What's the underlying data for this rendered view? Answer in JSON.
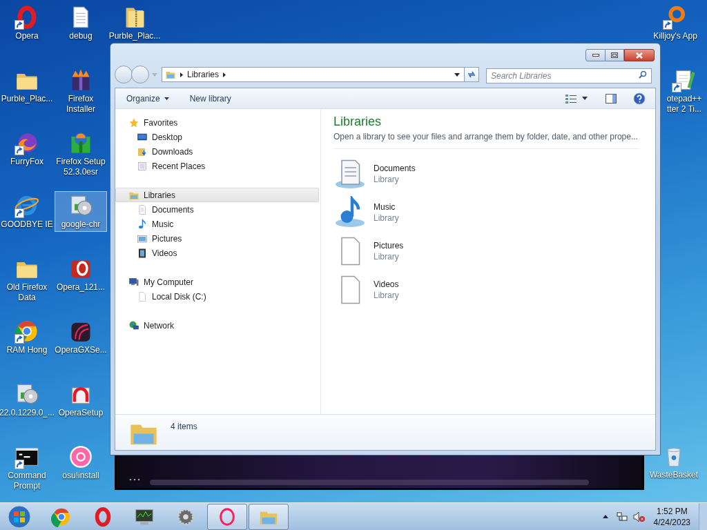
{
  "desktop_icons": [
    {
      "lines": [
        "Opera"
      ],
      "kind": "opera",
      "shortcut": true,
      "selected": false
    },
    {
      "lines": [
        "Purble_Plac..."
      ],
      "kind": "folder",
      "shortcut": false,
      "selected": false
    },
    {
      "lines": [
        "FurryFox"
      ],
      "kind": "firefox",
      "shortcut": true,
      "selected": false
    },
    {
      "lines": [
        "GOODBYE IE"
      ],
      "kind": "ie",
      "shortcut": true,
      "selected": false
    },
    {
      "lines": [
        "Old Firefox",
        "Data"
      ],
      "kind": "folder",
      "shortcut": false,
      "selected": false
    },
    {
      "lines": [
        "RAM Hong"
      ],
      "kind": "chrome",
      "shortcut": true,
      "selected": false
    },
    {
      "lines": [
        "22.0.1229.0_..."
      ],
      "kind": "disc",
      "shortcut": false,
      "selected": false
    },
    {
      "lines": [
        "Command",
        "Prompt"
      ],
      "kind": "cmd",
      "shortcut": true,
      "selected": false
    },
    {
      "lines": [
        "debug"
      ],
      "kind": "text",
      "shortcut": false,
      "selected": false
    },
    {
      "lines": [
        "Firefox",
        "Installer"
      ],
      "kind": "firefox-box",
      "shortcut": false,
      "selected": false
    },
    {
      "lines": [
        "Firefox Setup",
        "52.3.0esr"
      ],
      "kind": "globe-box",
      "shortcut": false,
      "selected": false
    },
    {
      "lines": [
        "google-chr"
      ],
      "kind": "disc",
      "shortcut": false,
      "selected": true
    },
    {
      "lines": [
        "Opera_121..."
      ],
      "kind": "opera-box",
      "shortcut": false,
      "selected": false
    },
    {
      "lines": [
        "OperaGXSe..."
      ],
      "kind": "gx",
      "shortcut": false,
      "selected": false
    },
    {
      "lines": [
        "OperaSetup"
      ],
      "kind": "opera-setup",
      "shortcut": false,
      "selected": false
    },
    {
      "lines": [
        "osu!install"
      ],
      "kind": "osu",
      "shortcut": false,
      "selected": false
    },
    {
      "lines": [
        "Purble_Plac..."
      ],
      "kind": "zip",
      "shortcut": false,
      "selected": false
    }
  ],
  "right_icons": [
    {
      "lines": [
        "Killjoy's App"
      ],
      "kind": "ring",
      "shortcut": true,
      "selected": false
    },
    {
      "lines": [
        "otepad++",
        "tter 2 Ti..."
      ],
      "kind": "notepad",
      "shortcut": true,
      "selected": false
    },
    {
      "lines": [
        "WasteBasket"
      ],
      "kind": "bin",
      "shortcut": false,
      "selected": false
    }
  ],
  "explorer": {
    "address": {
      "crumbs": [
        "Libraries"
      ]
    },
    "search": {
      "placeholder": "Search Libraries"
    },
    "toolbar": [
      "Organize",
      "New library"
    ],
    "nav": [
      {
        "label": "Favorites",
        "kind": "star",
        "selected": false,
        "children": [
          {
            "label": "Desktop",
            "kind": "desktop",
            "selected": false
          },
          {
            "label": "Downloads",
            "kind": "downloads",
            "selected": false
          },
          {
            "label": "Recent Places",
            "kind": "recent",
            "selected": false
          }
        ]
      },
      {
        "label": "Libraries",
        "kind": "library",
        "selected": true,
        "children": [
          {
            "label": "Documents",
            "kind": "document",
            "selected": false
          },
          {
            "label": "Music",
            "kind": "music",
            "selected": false
          },
          {
            "label": "Pictures",
            "kind": "pictures",
            "selected": false
          },
          {
            "label": "Videos",
            "kind": "videos",
            "selected": false
          }
        ]
      },
      {
        "label": "My Computer",
        "kind": "computer",
        "selected": false,
        "children": [
          {
            "label": "Local Disk (C:)",
            "kind": "page",
            "selected": false
          }
        ]
      },
      {
        "label": "Network",
        "kind": "network",
        "selected": false
      }
    ],
    "heading": "Libraries",
    "description": "Open a library to see your files and arrange them by folder, date, and other prope...",
    "items": [
      {
        "name": "Documents",
        "type": "Library",
        "kind": "doc-library"
      },
      {
        "name": "Music",
        "type": "Library",
        "kind": "music-library"
      },
      {
        "name": "Pictures",
        "type": "Library",
        "kind": "page"
      },
      {
        "name": "Videos",
        "type": "Library",
        "kind": "page"
      }
    ],
    "status": "4 items"
  },
  "taskbar": {
    "items": [
      {
        "kind": "chrome",
        "active": false
      },
      {
        "kind": "opera",
        "active": false
      },
      {
        "kind": "monitor",
        "active": false
      },
      {
        "kind": "gear",
        "active": false
      },
      {
        "kind": "ring-pink",
        "active": true
      },
      {
        "kind": "explorer",
        "active": true
      }
    ],
    "time": "1:52 PM",
    "date": "4/24/2023"
  }
}
